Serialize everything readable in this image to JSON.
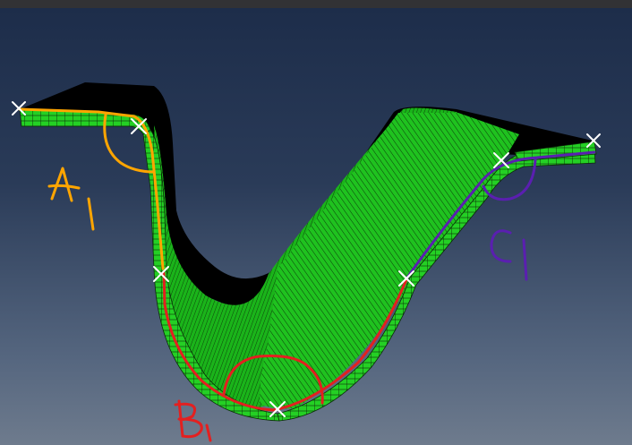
{
  "viewport": {
    "background_top": "#1d2d4a",
    "background_bottom": "#6e7b8d",
    "model": {
      "mesh_color": "#1fc21f",
      "mesh_line_color": "#0b2a08",
      "shadow_color": "#000000"
    },
    "annotations": {
      "section_a": {
        "label": "A1",
        "color": "#ffa500"
      },
      "section_b": {
        "label": "B1",
        "color": "#e32020"
      },
      "section_c": {
        "label": "C1",
        "color": "#5a1fb0"
      },
      "marker_color": "#ffffff",
      "marker_icon": "x-mark-icon"
    }
  }
}
